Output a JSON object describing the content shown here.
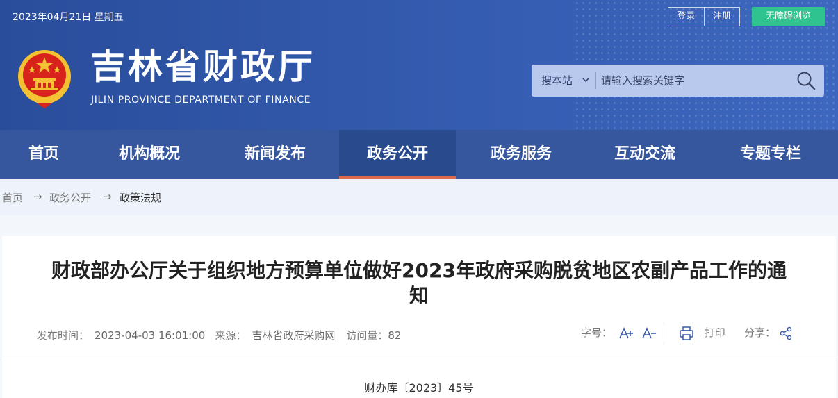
{
  "topbar": {
    "date": "2023年04月21日  星期五",
    "login_label": "登录",
    "register_label": "注册",
    "accessibility_label": "无障碍浏览"
  },
  "site": {
    "title": "吉林省财政厅",
    "subtitle": "JILIN PROVINCE DEPARTMENT OF FINANCE"
  },
  "search": {
    "scope_label": "搜本站",
    "placeholder": "请输入搜索关键字"
  },
  "nav": {
    "items": [
      {
        "label": "首页"
      },
      {
        "label": "机构概况"
      },
      {
        "label": "新闻发布"
      },
      {
        "label": "政务公开",
        "active": true
      },
      {
        "label": "政务服务"
      },
      {
        "label": "互动交流"
      },
      {
        "label": "专题专栏"
      }
    ]
  },
  "breadcrumb": {
    "items": [
      "首页",
      "政务公开",
      "政策法规"
    ],
    "separator": "→"
  },
  "article": {
    "title": "财政部办公厅关于组织地方预算单位做好2023年政府采购脱贫地区农副产品工作的通知",
    "publish_label": "发布时间：",
    "publish_time": "2023-04-03 16:01:00",
    "source_label": "来源：",
    "source": "吉林省政府采购网",
    "views_label": "访问量：",
    "views": "82",
    "font_size_label": "字号：",
    "font_increase": "A+",
    "font_decrease": "A-",
    "print_label": "打印",
    "share_label": "分享：",
    "doc_number": "财办库〔2023〕45号"
  },
  "colors": {
    "header_bg": "#3259ac",
    "nav_bg": "#36569e",
    "nav_active_bg": "#2a4a8e",
    "nav_active_underline": "#e06b4c",
    "accessibility_bg": "#2fc38f",
    "emblem_red": "#d8231c",
    "emblem_gold": "#f3c131"
  },
  "icons": [
    "emblem-icon",
    "chevron-down-icon",
    "search-icon",
    "arrow-right-icon",
    "font-increase-icon",
    "font-decrease-icon",
    "print-icon",
    "share-icon"
  ]
}
